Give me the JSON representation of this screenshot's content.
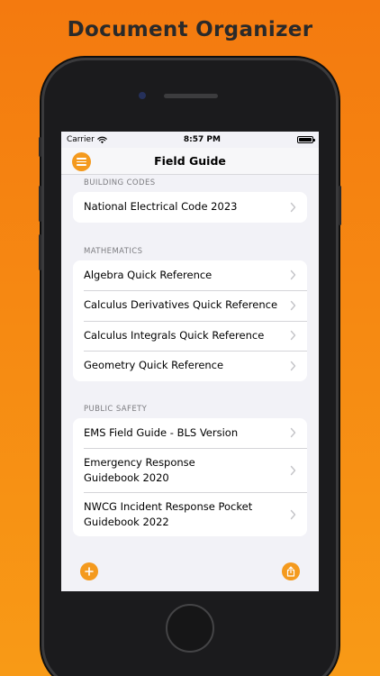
{
  "promo": {
    "headline": "Document Organizer"
  },
  "status_bar": {
    "carrier": "Carrier",
    "time": "8:57 PM"
  },
  "nav": {
    "title": "Field Guide"
  },
  "sections": [
    {
      "header": "BUILDING CODES",
      "items": [
        "National Electrical Code 2023"
      ]
    },
    {
      "header": "MATHEMATICS",
      "items": [
        "Algebra Quick Reference",
        "Calculus Derivatives Quick Reference",
        "Calculus Integrals Quick Reference",
        "Geometry Quick Reference"
      ]
    },
    {
      "header": "PUBLIC SAFETY",
      "items": [
        "EMS Field Guide - BLS Version",
        "Emergency Response\nGuidebook 2020",
        "NWCG Incident Response Pocket\nGuidebook 2022"
      ]
    }
  ],
  "colors": {
    "accent": "#F49A1E",
    "background_top": "#F47A0F",
    "background_bottom": "#F89A16"
  },
  "icons": {
    "menu": "hamburger-icon",
    "add": "plus-icon",
    "share": "share-icon",
    "disclosure": "chevron-right-icon"
  }
}
